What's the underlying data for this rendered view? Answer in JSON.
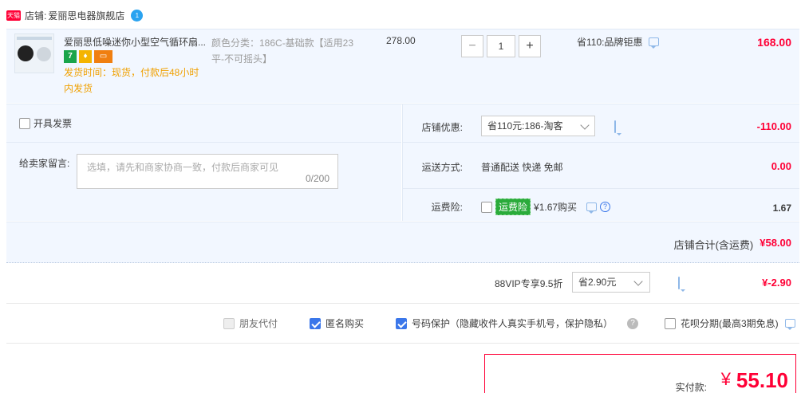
{
  "shop": {
    "badge": "天猫",
    "label": "店铺:",
    "name": "爱丽思电器旗舰店",
    "chat_badge": "1"
  },
  "item": {
    "title": "爱丽思低噪迷你小型空气循环扇...",
    "badges": [
      "7",
      "",
      ""
    ],
    "ship_time": "发货时间：现货，付款后48小时内发货",
    "sku": "颜色分类：186C-基础款【适用23平-不可摇头】",
    "unit_price": "278.00",
    "qty_minus": "−",
    "qty": "1",
    "qty_plus": "+",
    "promo": "省110:品牌钜惠",
    "total": "168.00"
  },
  "invoice": {
    "label": "开具发票"
  },
  "message": {
    "label": "给卖家留言:",
    "placeholder": "选填，请先和商家协商一致，付款后商家可见",
    "count": "0/200"
  },
  "discount": {
    "label": "店铺优惠:",
    "selected": "省110元:186-淘客",
    "value": "-110.00"
  },
  "shipping": {
    "label": "运送方式:",
    "text": "普通配送 快递 免邮",
    "value": "0.00"
  },
  "insurance": {
    "label": "运费险:",
    "tag": "运费险",
    "text": "¥1.67购买",
    "help": "?",
    "value": "1.67"
  },
  "store_total": {
    "label": "店铺合计(含运费)",
    "value": "¥58.00"
  },
  "vip": {
    "label": "88VIP专享9.5折",
    "selected": "省2.90元",
    "value": "¥-2.90"
  },
  "options": {
    "friend_pay": "朋友代付",
    "anonymous": "匿名购买",
    "number_protect": "号码保护（隐藏收件人真实手机号，保护隐私）",
    "help": "?",
    "huabei": "花呗分期(最高3期免息)"
  },
  "payment": {
    "label": "实付款:",
    "currency": "¥",
    "value": "55.10"
  },
  "colors": {
    "accent": "#ff0036",
    "panel": "#f2f7ff",
    "check": "#3b77ea",
    "tmall": "#ff0036"
  }
}
